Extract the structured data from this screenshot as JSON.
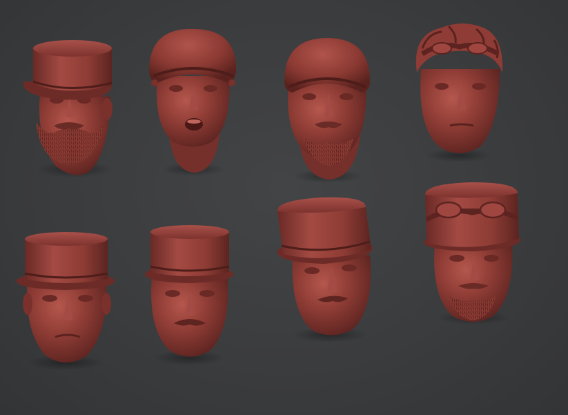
{
  "scene": {
    "background_color": "#3a3b3d",
    "material_color": "#8a3a34",
    "heads": [
      {
        "id": "head-1",
        "headwear": "kepi",
        "features": [
          "beard",
          "mustache"
        ]
      },
      {
        "id": "head-2",
        "headwear": "helmet",
        "features": [
          "open-mouth"
        ]
      },
      {
        "id": "head-3",
        "headwear": "helmet",
        "features": [
          "goatee"
        ]
      },
      {
        "id": "head-4",
        "headwear": "goggles-on-hair",
        "features": []
      },
      {
        "id": "head-5",
        "headwear": "kepi",
        "features": []
      },
      {
        "id": "head-6",
        "headwear": "kepi",
        "features": [
          "mustache"
        ]
      },
      {
        "id": "head-7",
        "headwear": "kepi",
        "features": [
          "mustache"
        ]
      },
      {
        "id": "head-8",
        "headwear": "kepi-with-goggles",
        "features": [
          "goatee"
        ]
      }
    ]
  }
}
